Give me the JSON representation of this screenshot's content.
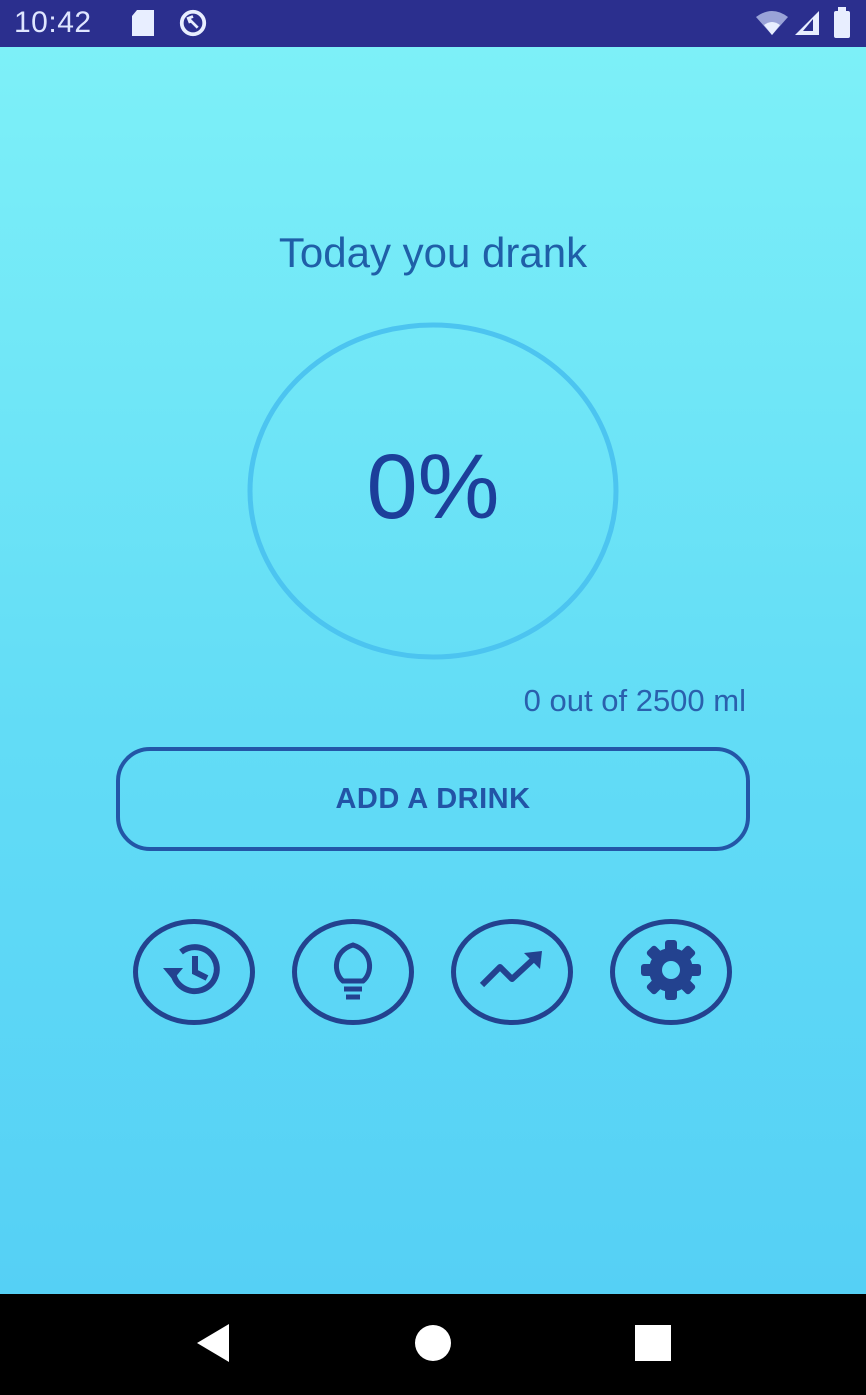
{
  "status_bar": {
    "time": "10:42",
    "left_icons": [
      "sd-card-icon",
      "sync-icon"
    ],
    "right_icons": [
      "wifi-icon",
      "signal-icon",
      "battery-icon"
    ]
  },
  "main": {
    "heading": "Today you drank",
    "progress_percent": 0,
    "percent_label": "0%",
    "amount_label": "0 out of 2500 ml",
    "add_button_label": "ADD A DRINK"
  },
  "actions": [
    {
      "name": "history",
      "icon": "history-icon"
    },
    {
      "name": "tips",
      "icon": "lightbulb-icon"
    },
    {
      "name": "statistics",
      "icon": "trending-up-icon"
    },
    {
      "name": "settings",
      "icon": "gear-icon"
    }
  ],
  "nav_bar": {
    "buttons": [
      "back-icon",
      "home-icon",
      "recents-icon"
    ]
  },
  "colors": {
    "status_bar": "#2b2f8e",
    "background_top": "#7df0f8",
    "background_bottom": "#55d0f5",
    "ring": "#4cc4f0",
    "primary": "#1c3f9a",
    "button_border": "#2356a7"
  }
}
